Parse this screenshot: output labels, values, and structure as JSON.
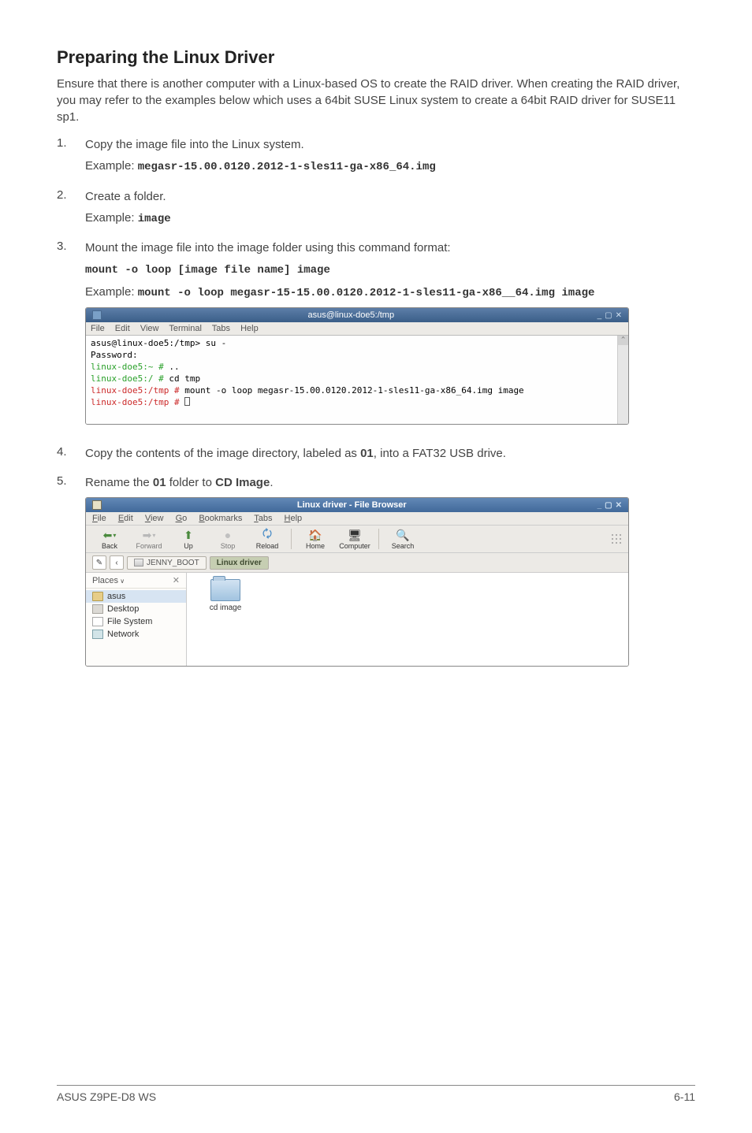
{
  "heading": "Preparing the Linux Driver",
  "intro": "Ensure that there is another computer with a Linux-based OS to create the RAID driver. When creating the RAID driver, you may refer to the examples below which uses a 64bit SUSE Linux system to create a 64bit RAID driver for SUSE11 sp1.",
  "steps": {
    "s1": {
      "num": "1.",
      "text": "Copy the image file into the Linux system.",
      "example_label": "Example: ",
      "example_code": "megasr-15.00.0120.2012-1-sles11-ga-x86_64.img"
    },
    "s2": {
      "num": "2.",
      "text": "Create a folder.",
      "example_label": "Example: ",
      "example_code": "image"
    },
    "s3": {
      "num": "3.",
      "text": "Mount the image file into the image folder using this command format:",
      "cmd_format": "mount -o loop [image file name] image",
      "example_label": "Example: ",
      "example_code": "mount -o loop megasr-15-15.00.0120.2012-1-sles11-ga-x86__64.img image"
    },
    "s4": {
      "num": "4.",
      "text_a": "Copy the contents of the image directory, labeled as ",
      "bold_a": "01",
      "text_b": ", into  a FAT32 USB drive."
    },
    "s5": {
      "num": "5.",
      "text_a": "Rename the ",
      "bold_a": "01",
      "text_b": " folder to ",
      "bold_b": "CD Image",
      "text_c": "."
    }
  },
  "terminal": {
    "title": "asus@linux-doe5:/tmp",
    "ctrl_min": "_",
    "ctrl_max": "▢",
    "ctrl_close": "✕",
    "menu": {
      "file": "File",
      "edit": "Edit",
      "view": "View",
      "term": "Terminal",
      "tabs": "Tabs",
      "help": "Help"
    },
    "lines": {
      "l1": "asus@linux-doe5:/tmp> su -",
      "l2": "Password:",
      "l3a": "linux-doe5:~ #",
      "l3b": " ..",
      "l4a": "linux-doe5:/ #",
      "l4b": " cd tmp",
      "l5a": "linux-doe5:/tmp #",
      "l5b": " mount -o loop megasr-15.00.0120.2012-1-sles11-ga-x86_64.img image",
      "l6": "linux-doe5:/tmp # "
    }
  },
  "filebrowser": {
    "title": "Linux driver - File Browser",
    "ctrl_min": "_",
    "ctrl_max": "▢",
    "ctrl_close": "✕",
    "menu": {
      "file": "File",
      "edit": "Edit",
      "view": "View",
      "go": "Go",
      "bookmarks": "Bookmarks",
      "tabs": "Tabs",
      "help": "Help"
    },
    "toolbar": {
      "back": "Back",
      "forward": "Forward",
      "up": "Up",
      "stop": "Stop",
      "reload": "Reload",
      "home": "Home",
      "computer": "Computer",
      "search": "Search"
    },
    "path": {
      "jenny": "JENNY_BOOT",
      "linuxdriver": "Linux driver"
    },
    "sidebar": {
      "header": "Places",
      "items": {
        "asus": "asus",
        "desktop": "Desktop",
        "fs": "File System",
        "network": "Network"
      }
    },
    "content": {
      "folder": "cd image"
    }
  },
  "footer": {
    "left": "ASUS Z9PE-D8 WS",
    "right": "6-11"
  }
}
